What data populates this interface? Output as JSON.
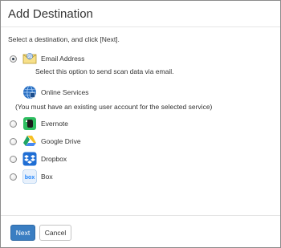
{
  "dialog": {
    "title": "Add Destination",
    "instruction": "Select a destination, and click [Next]."
  },
  "options": [
    {
      "id": "email",
      "label": "Email Address",
      "selected": true,
      "icon": "email-icon",
      "description": "Select this option to send scan data via email."
    },
    {
      "id": "online",
      "label": "Online Services",
      "icon": "online-services-icon",
      "note": "(You must have an existing user account for the selected service)"
    },
    {
      "id": "evernote",
      "label": "Evernote",
      "selected": false,
      "icon": "evernote-icon"
    },
    {
      "id": "gdrive",
      "label": "Google Drive",
      "selected": false,
      "icon": "google-drive-icon"
    },
    {
      "id": "dropbox",
      "label": "Dropbox",
      "selected": false,
      "icon": "dropbox-icon"
    },
    {
      "id": "box",
      "label": "Box",
      "selected": false,
      "icon": "box-icon"
    }
  ],
  "footer": {
    "next_label": "Next",
    "cancel_label": "Cancel"
  },
  "colors": {
    "primary_button": "#3a7ec2",
    "evernote": "#2dbe60",
    "dropbox": "#1f6ed4",
    "box": "#2486fc"
  }
}
